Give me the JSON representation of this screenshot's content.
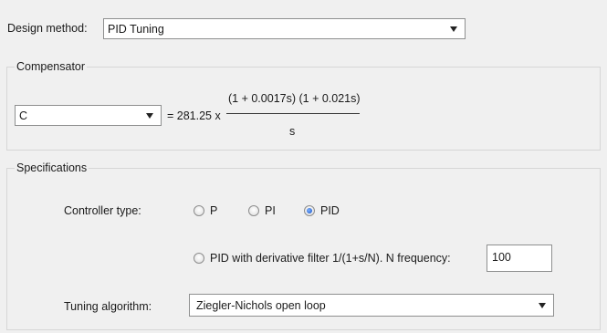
{
  "design_method": {
    "label": "Design method:",
    "selected": "PID Tuning"
  },
  "compensator": {
    "group_title": "Compensator",
    "name_selected": "C",
    "equals_gain": "= 281.25 x",
    "numerator": "(1 + 0.0017s) (1 + 0.021s)",
    "denominator": "s"
  },
  "specifications": {
    "group_title": "Specifications",
    "controller_type_label": "Controller type:",
    "options": [
      {
        "label": "P",
        "checked": false
      },
      {
        "label": "PI",
        "checked": false
      },
      {
        "label": "PID",
        "checked": true
      }
    ],
    "derivative_filter_label": "PID with derivative filter 1/(1+s/N). N frequency:",
    "derivative_filter_checked": false,
    "n_frequency": "100",
    "tuning_algorithm_label": "Tuning algorithm:",
    "tuning_algorithm_selected": "Ziegler-Nichols open loop"
  }
}
